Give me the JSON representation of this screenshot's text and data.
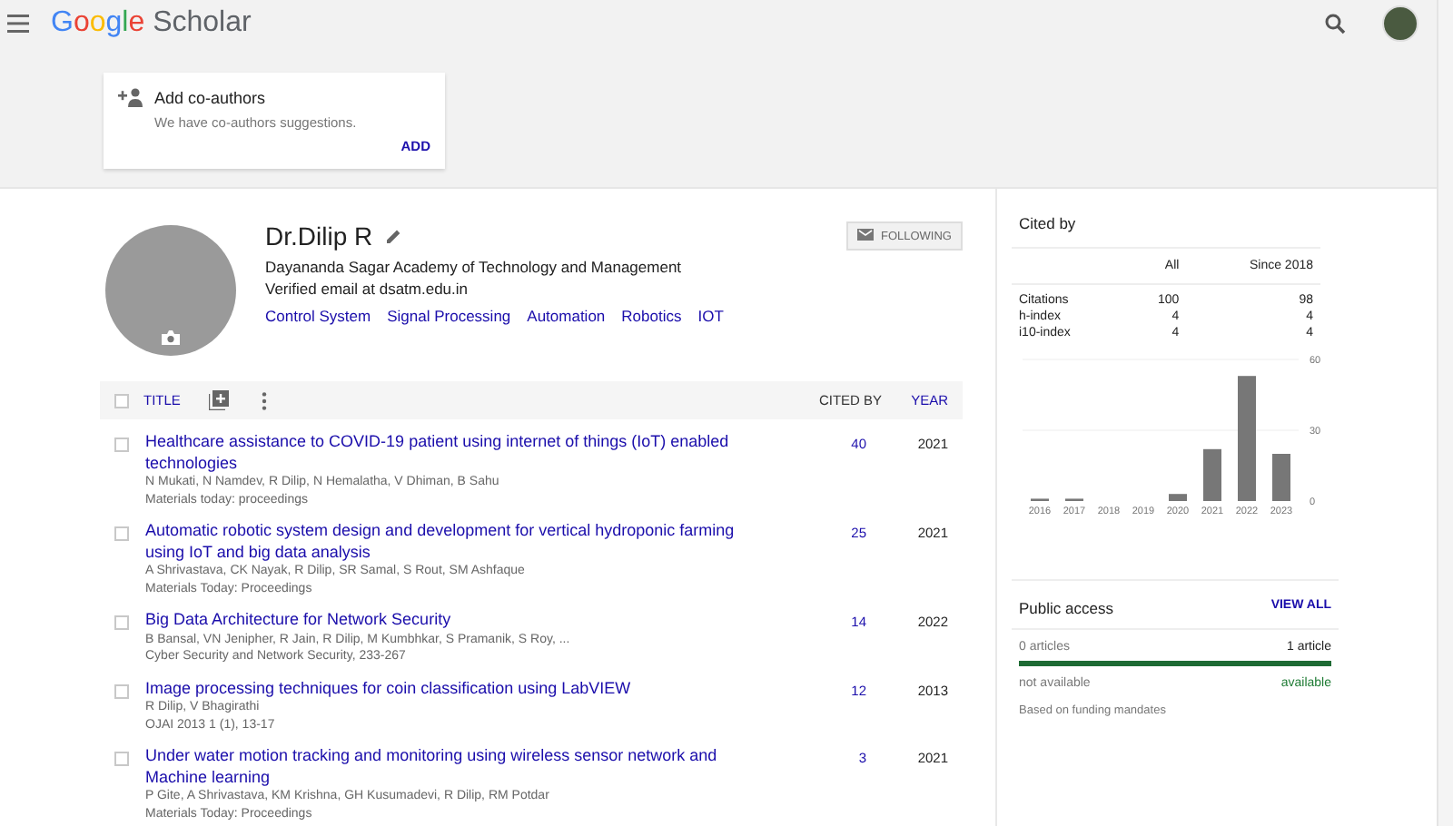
{
  "header": {
    "logo": {
      "brand": "Google",
      "product": "Scholar"
    }
  },
  "coauthor_card": {
    "title": "Add co-authors",
    "text": "We have co-authors suggestions.",
    "action": "ADD"
  },
  "profile": {
    "name": "Dr.Dilip R",
    "affiliation": "Dayananda Sagar Academy of Technology and Management",
    "email": "Verified email at dsatm.edu.in",
    "interests": [
      "Control System",
      "Signal Processing",
      "Automation",
      "Robotics",
      "IOT"
    ],
    "follow_button": "FOLLOWING"
  },
  "table": {
    "select_all": {
      "checked": false
    },
    "columns": [
      {
        "label": "TITLE",
        "kind": "link"
      },
      {
        "label": "CITED BY",
        "kind": "plain"
      },
      {
        "label": "YEAR",
        "kind": "link"
      }
    ],
    "rows": [
      {
        "checked": false,
        "title": "Healthcare assistance to COVID-19 patient using internet of things (IoT) enabled technologies",
        "authors": "N Mukati, N Namdev, R Dilip, N Hemalatha, V Dhiman, B Sahu",
        "venue": "Materials today: proceedings",
        "cited_by": "40",
        "year": "2021"
      },
      {
        "checked": false,
        "title": "Automatic robotic system design and development for vertical hydroponic farming using IoT and big data analysis",
        "authors": "A Shrivastava, CK Nayak, R Dilip, SR Samal, S Rout, SM Ashfaque",
        "venue": "Materials Today: Proceedings",
        "cited_by": "25",
        "year": "2021"
      },
      {
        "checked": false,
        "title": "Big Data Architecture for Network Security",
        "authors": "B Bansal, VN Jenipher, R Jain, R Dilip, M Kumbhkar, S Pramanik, S Roy, ...",
        "venue": "Cyber Security and Network Security, 233-267",
        "cited_by": "14",
        "year": "2022"
      },
      {
        "checked": false,
        "title": "Image processing techniques for coin classification using LabVIEW",
        "authors": "R Dilip, V Bhagirathi",
        "venue": "OJAI 2013 1 (1), 13-17",
        "cited_by": "12",
        "year": "2013"
      },
      {
        "checked": false,
        "title": "Under water motion tracking and monitoring using wireless sensor network and Machine learning",
        "authors": "P Gite, A Shrivastava, KM Krishna, GH Kusumadevi, R Dilip, RM Potdar",
        "venue": "Materials Today: Proceedings",
        "cited_by": "3",
        "year": "2021"
      }
    ]
  },
  "cited_by": {
    "title": "Cited by",
    "columns": [
      "All",
      "Since 2018"
    ],
    "rows": [
      {
        "label": "Citations",
        "all": "100",
        "since": "98"
      },
      {
        "label": "h-index",
        "all": "4",
        "since": "4"
      },
      {
        "label": "i10-index",
        "all": "4",
        "since": "4"
      }
    ],
    "chart_data": {
      "type": "bar",
      "categories": [
        "2016",
        "2017",
        "2018",
        "2019",
        "2020",
        "2021",
        "2022",
        "2023"
      ],
      "values": [
        1,
        1,
        0,
        0,
        3,
        22,
        53,
        20
      ],
      "ylim": [
        0,
        60
      ],
      "yticks": [
        0,
        30,
        60
      ]
    }
  },
  "public_access": {
    "title": "Public access",
    "action": "VIEW ALL",
    "left_count": "0 articles",
    "right_count": "1 article",
    "level": 1,
    "left_label": "not available",
    "right_label": "available",
    "note": "Based on funding mandates"
  }
}
